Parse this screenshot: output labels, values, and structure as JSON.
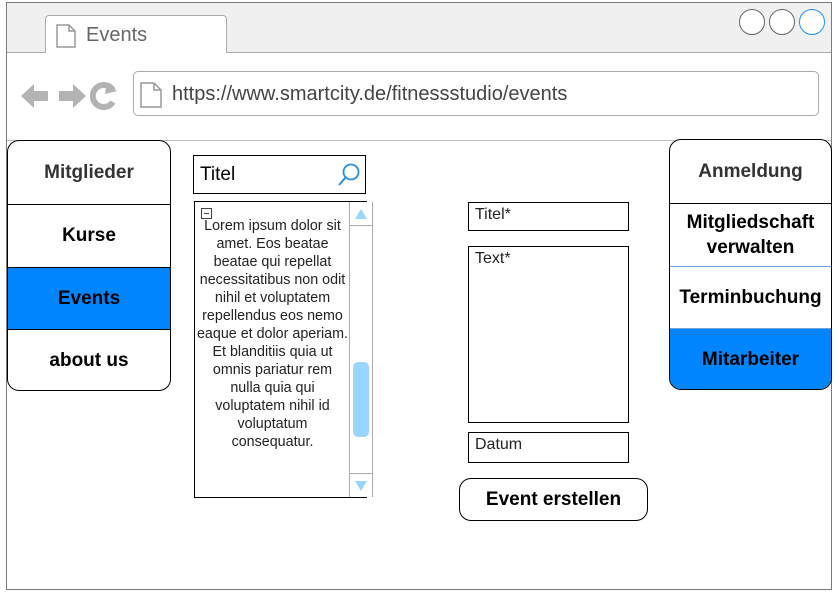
{
  "browser": {
    "tab_title": "Events",
    "url": "https://www.smartcity.de/fitnessstudio/events"
  },
  "left_menu": {
    "items": [
      {
        "label": "Mitglieder"
      },
      {
        "label": "Kurse"
      },
      {
        "label": "Events"
      },
      {
        "label": "about us"
      }
    ],
    "active": "Events"
  },
  "right_menu": {
    "items": [
      {
        "label": "Anmeldung"
      },
      {
        "label": "Mitgliedschaft\nverwalten"
      },
      {
        "label": "Terminbuchung"
      },
      {
        "label": "Mitarbeiter"
      }
    ],
    "active": "Mitarbeiter"
  },
  "search": {
    "value": "Titel"
  },
  "text_panel": {
    "content": "Lorem ipsum dolor sit amet. Eos beatae beatae qui repellat necessitatibus non odit nihil et voluptatem repellendus eos nemo eaque et dolor aperiam. Et blanditiis quia ut omnis pariatur rem nulla quia qui voluptatem nihil id voluptatum consequatur."
  },
  "form": {
    "title_placeholder": "Titel*",
    "text_placeholder": "Text*",
    "date_placeholder": "Datum",
    "submit_label": "Event erstellen"
  },
  "colors": {
    "accent": "#0085fc",
    "scroll_thumb": "#99d6ff",
    "window_button_active": "#1e90ff"
  }
}
